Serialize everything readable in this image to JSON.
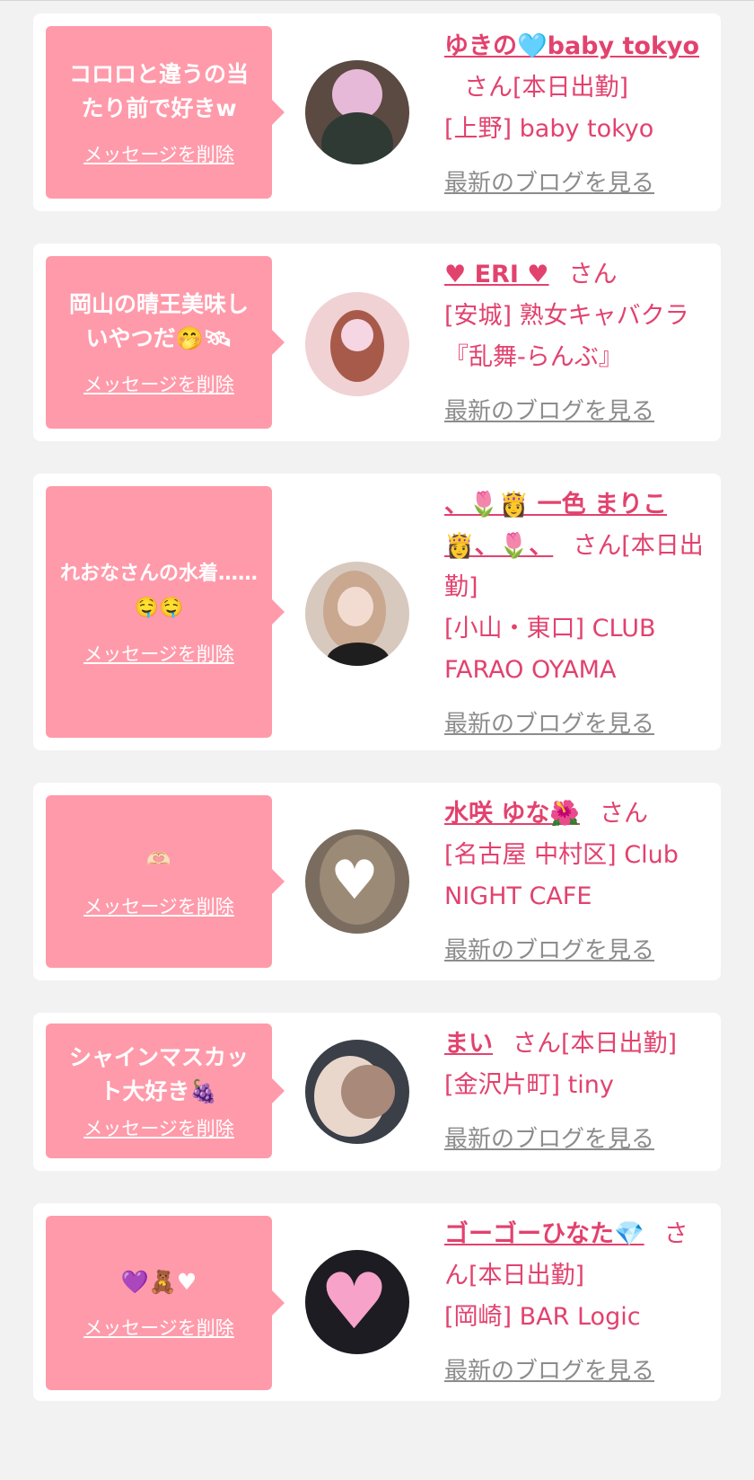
{
  "cards": [
    {
      "message": "コロロと違うの当たり前で好きw",
      "delete_label": "メッセージを削除",
      "name": "ゆきの🩵baby tokyo",
      "suffix": "さん[本日出勤]",
      "shop": "[上野] baby tokyo",
      "blog_label": "最新のブログを見る"
    },
    {
      "message": "岡山の晴王美味しいやつだ🤭🛰",
      "delete_label": "メッセージを削除",
      "name": "♥ ERI ♥",
      "suffix": "さん",
      "shop": "[安城] 熟女キャバクラ『乱舞-らんぶ』",
      "blog_label": "最新のブログを見る"
    },
    {
      "message": "れおなさんの水着……🤤🤤",
      "delete_label": "メッセージを削除",
      "name": "、🌷👸 一色 まりこ 👸、🌷、",
      "suffix": "さん[本日出勤]",
      "shop": "[小山・東口] CLUB FARAO OYAMA",
      "blog_label": "最新のブログを見る"
    },
    {
      "message": "🫶🏻",
      "delete_label": "メッセージを削除",
      "name": "水咲 ゆな🌺",
      "suffix": "さん",
      "shop": "[名古屋 中村区] Club NIGHT CAFE",
      "blog_label": "最新のブログを見る"
    },
    {
      "message": "シャインマスカット大好き🍇",
      "delete_label": "メッセージを削除",
      "name": "まい",
      "suffix": "さん[本日出勤]",
      "shop": "[金沢片町] tiny",
      "blog_label": "最新のブログを見る"
    },
    {
      "message": "💜🧸♥",
      "delete_label": "メッセージを削除",
      "name": "ゴーゴーひなた💎",
      "suffix": "さん[本日出勤]",
      "shop": "[岡崎] BAR Logic",
      "blog_label": "最新のブログを見る"
    }
  ]
}
